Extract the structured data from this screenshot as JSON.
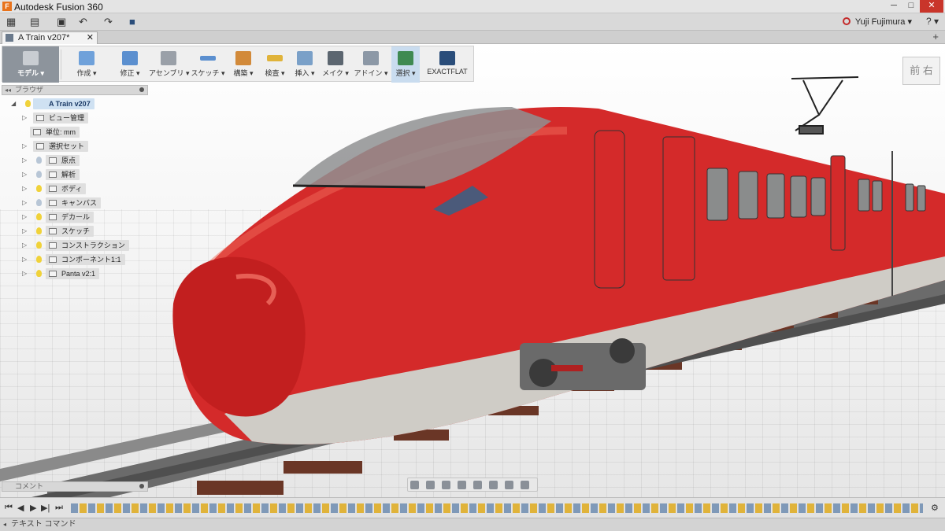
{
  "window": {
    "title": "Autodesk Fusion 360",
    "logo_letter": "F",
    "minimize": "─",
    "maximize": "□",
    "close": "✕"
  },
  "quick_access": {
    "grid_icon": "▦",
    "file_icon": "▤",
    "save_icon": "▣",
    "undo_icon": "↶",
    "redo_icon": "↷",
    "stop_icon": "■",
    "user": "Yuji Fujimura ▾",
    "help": "? ▾"
  },
  "document_tab": {
    "label": "A Train v207*",
    "close": "✕",
    "new_tab": "+"
  },
  "toolbar": {
    "items": [
      {
        "label": "モデル ▾"
      },
      {
        "label": "作成 ▾"
      },
      {
        "label": "修正 ▾"
      },
      {
        "label": "アセンブリ ▾"
      },
      {
        "label": "スケッチ ▾"
      },
      {
        "label": "構築 ▾"
      },
      {
        "label": "検査 ▾"
      },
      {
        "label": "挿入 ▾"
      },
      {
        "label": "メイク ▾"
      },
      {
        "label": "アドイン ▾"
      },
      {
        "label": "選択 ▾"
      },
      {
        "label": "EXACTFLAT"
      }
    ]
  },
  "browser": {
    "title": "ブラウザ",
    "collapse": "◂◂",
    "root": "A Train v207",
    "nodes": [
      {
        "label": "ビュー管理"
      },
      {
        "label": "単位: mm"
      },
      {
        "label": "選択セット"
      },
      {
        "label": "原点"
      },
      {
        "label": "解析"
      },
      {
        "label": "ボディ"
      },
      {
        "label": "キャンバス"
      },
      {
        "label": "デカール"
      },
      {
        "label": "スケッチ"
      },
      {
        "label": "コンストラクション"
      },
      {
        "label": "コンポーネント1:1"
      },
      {
        "label": "Panta v2:1"
      }
    ]
  },
  "viewcube": {
    "face": "前 右"
  },
  "comments": {
    "title": "コメント"
  },
  "timeline": {
    "first": "⏮",
    "prev": "◀",
    "play": "▶",
    "next": "▶|",
    "last": "⏭",
    "settings": "⚙"
  },
  "command_bar": {
    "label": "テキスト コマンド",
    "arrow": "◂"
  }
}
